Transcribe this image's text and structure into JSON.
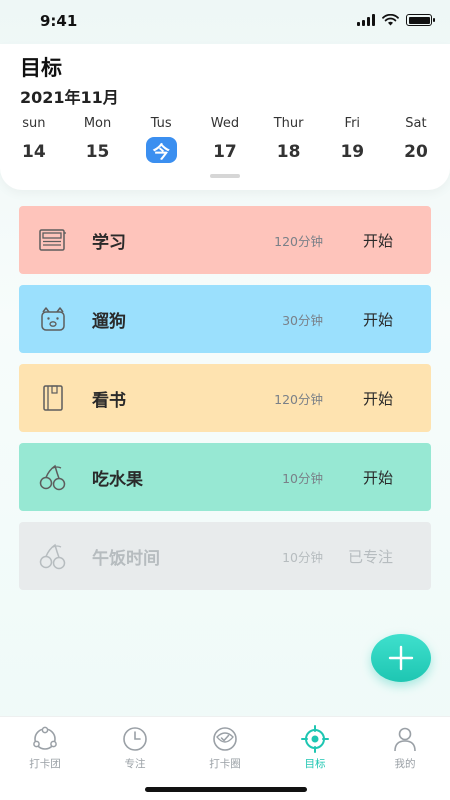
{
  "status_bar": {
    "time": "9:41"
  },
  "header": {
    "title": "目标",
    "month": "2021年11月",
    "week": [
      {
        "name": "sun",
        "date": "14",
        "today": false
      },
      {
        "name": "Mon",
        "date": "15",
        "today": false
      },
      {
        "name": "Tus",
        "date": "今",
        "today": true
      },
      {
        "name": "Wed",
        "date": "17",
        "today": false
      },
      {
        "name": "Thur",
        "date": "18",
        "today": false
      },
      {
        "name": "Fri",
        "date": "19",
        "today": false
      },
      {
        "name": "Sat",
        "date": "20",
        "today": false
      }
    ]
  },
  "tasks": [
    {
      "name": "学习",
      "duration": "120分钟",
      "action": "开始",
      "color": "#fec4bb",
      "icon": "notebook-icon"
    },
    {
      "name": "遛狗",
      "duration": "30分钟",
      "action": "开始",
      "color": "#9be0fd",
      "icon": "dog-icon"
    },
    {
      "name": "看书",
      "duration": "120分钟",
      "action": "开始",
      "color": "#fee3b0",
      "icon": "book-icon"
    },
    {
      "name": "吃水果",
      "duration": "10分钟",
      "action": "开始",
      "color": "#97e8d3",
      "icon": "cherry-icon"
    },
    {
      "name": "午饭时间",
      "duration": "10分钟",
      "action": "已专注",
      "color": "#e8ebec",
      "icon": "cherry-icon"
    }
  ],
  "fab": {
    "icon": "plus-icon",
    "color": "#1ec6b2"
  },
  "tab_bar": {
    "tabs": [
      {
        "label": "打卡团",
        "icon": "group-icon",
        "active": false
      },
      {
        "label": "专注",
        "icon": "clock-icon",
        "active": false
      },
      {
        "label": "打卡圈",
        "icon": "circle-check-icon",
        "active": false
      },
      {
        "label": "目标",
        "icon": "target-icon",
        "active": true
      },
      {
        "label": "我的",
        "icon": "person-icon",
        "active": false
      }
    ],
    "active_color": "#1ec6b2",
    "inactive_color": "#9aa0a6"
  }
}
